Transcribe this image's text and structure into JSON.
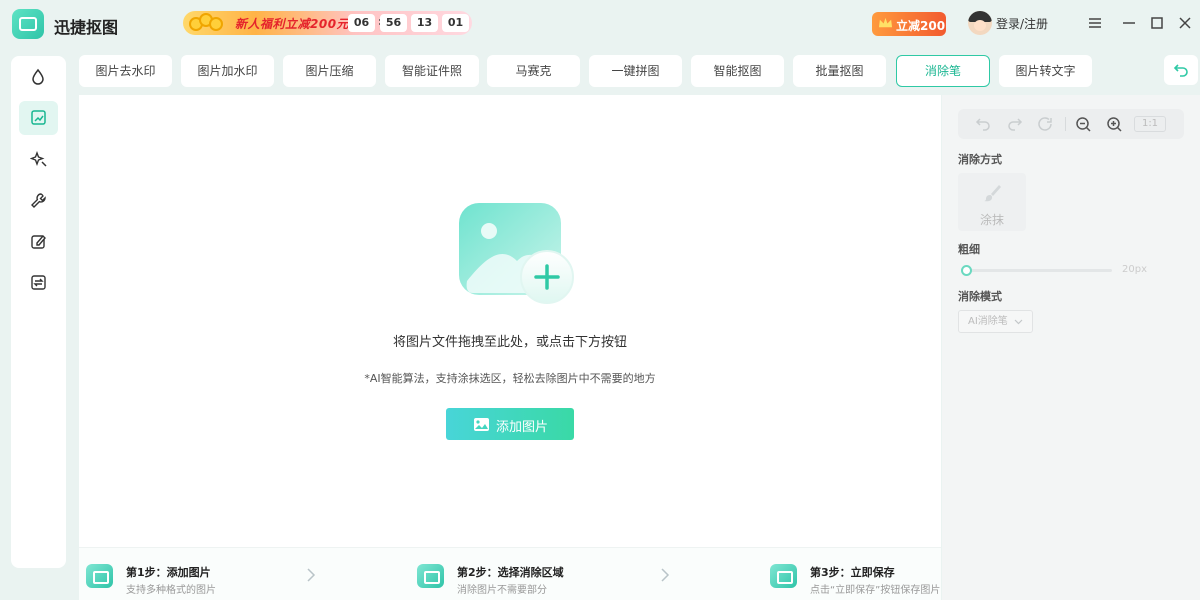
{
  "app": {
    "title": "迅捷抠图"
  },
  "promo": {
    "text": "新人福利立减200元",
    "countdown": [
      "06",
      "56",
      "13",
      "01"
    ]
  },
  "header": {
    "vip_label": "立减200",
    "login_label": "登录/注册"
  },
  "sidebar": {
    "items": [
      {
        "icon": "drop-icon"
      },
      {
        "icon": "image-edit-icon",
        "active": true
      },
      {
        "icon": "magic-wand-icon"
      },
      {
        "icon": "wrench-icon"
      },
      {
        "icon": "edit-icon"
      },
      {
        "icon": "convert-icon"
      }
    ]
  },
  "tabs": [
    {
      "label": "图片去水印"
    },
    {
      "label": "图片加水印"
    },
    {
      "label": "图片压缩"
    },
    {
      "label": "智能证件照"
    },
    {
      "label": "马赛克"
    },
    {
      "label": "一键拼图"
    },
    {
      "label": "智能抠图"
    },
    {
      "label": "批量抠图"
    },
    {
      "label": "消除笔",
      "active": true
    },
    {
      "label": "图片转文字"
    }
  ],
  "main": {
    "drop_text": "将图片文件拖拽至此处，或点击下方按钮",
    "tip_text": "*AI智能算法，支持涂抹选区，轻松去除图片中不需要的地方",
    "add_button": "添加图片"
  },
  "steps": [
    {
      "title": "第1步：添加图片",
      "desc": "支持多种格式的图片"
    },
    {
      "title": "第2步：选择消除区域",
      "desc": "消除图片不需要部分"
    },
    {
      "title": "第3步：立即保存",
      "desc": "点击“立即保存”按钮保存图片"
    }
  ],
  "panel": {
    "zoom_label": "1:1",
    "method_label": "消除方式",
    "method_option": "涂抹",
    "size_label": "粗细",
    "size_value": "20px",
    "mode_label": "消除模式",
    "mode_value": "AI消除笔"
  },
  "colors": {
    "accent": "#2fc9a5",
    "promo_text": "#e5242c",
    "vip_badge": "#f25a2f"
  }
}
